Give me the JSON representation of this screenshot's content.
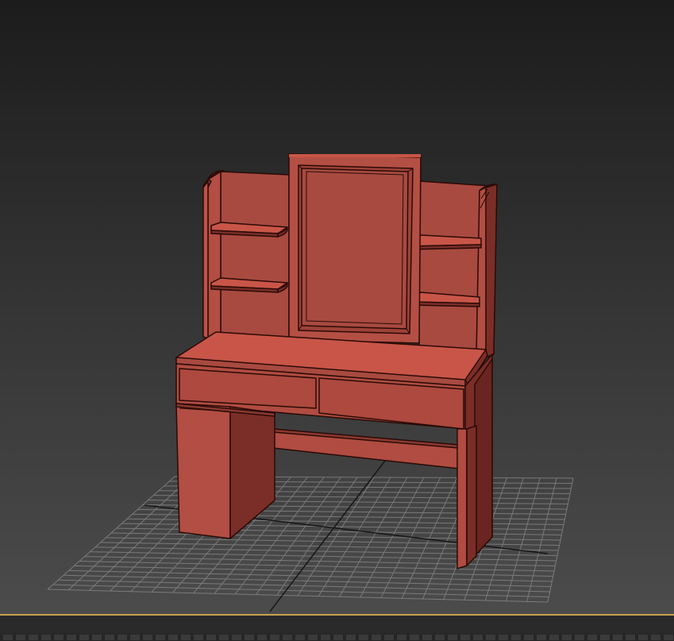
{
  "viewport": {
    "label": "",
    "background_top": "#1d1d1d",
    "background_bottom": "#4a4a4a",
    "grid_color": "#8a8a8a",
    "grid_axis_color": "#1a1a1a",
    "frame_line_color": "#c9a34a"
  },
  "model": {
    "name": "dressing-table",
    "base_color": "#a9463c",
    "light_color": "#c85548",
    "mid_color": "#a84a40",
    "dark_color": "#7a2e27",
    "shadow_color": "#5a1e19",
    "edge_color": "#2a0a07"
  }
}
